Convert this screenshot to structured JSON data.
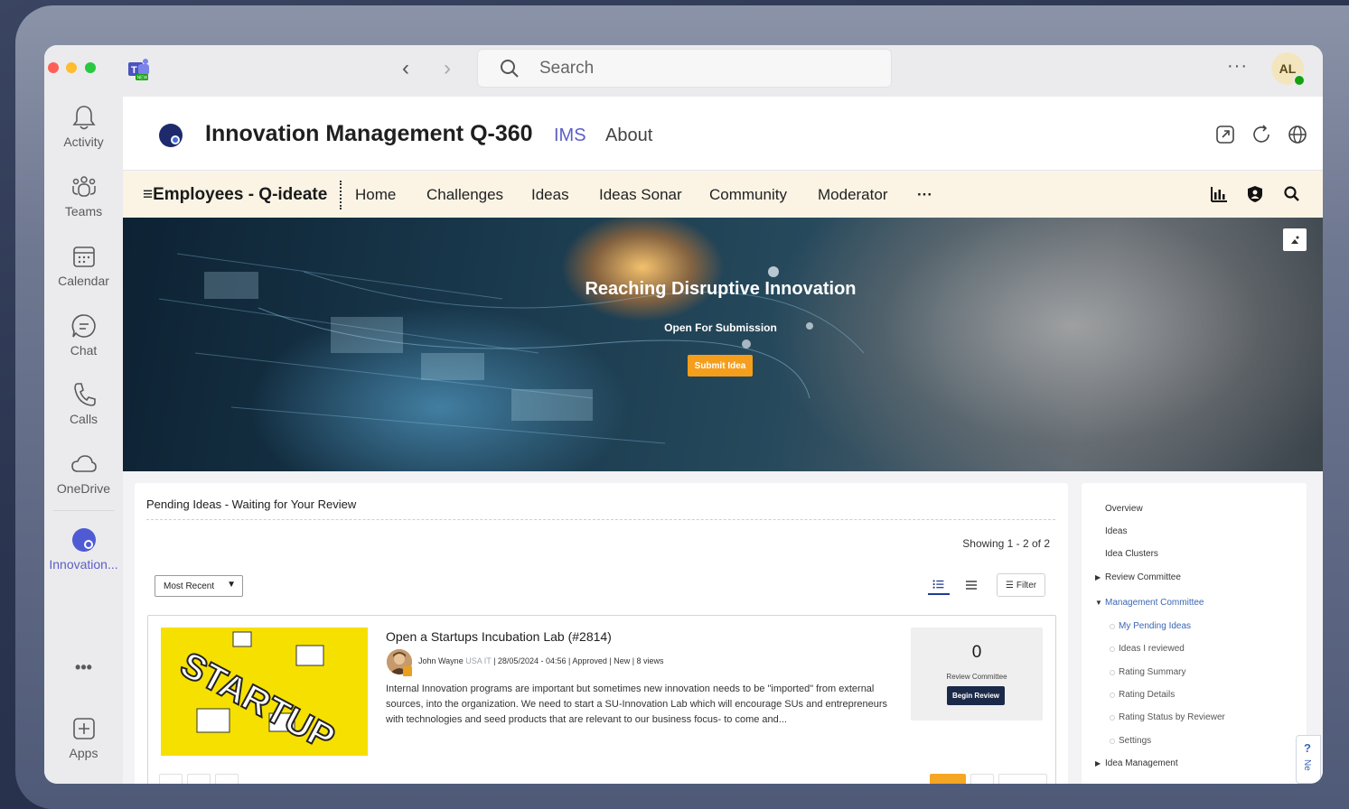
{
  "titlebar": {
    "search_placeholder": "Search",
    "more": "···",
    "avatar_initials": "AL"
  },
  "rail": {
    "items": [
      {
        "label": "Activity",
        "icon": "bell-icon"
      },
      {
        "label": "Teams",
        "icon": "teams-icon"
      },
      {
        "label": "Calendar",
        "icon": "calendar-icon"
      },
      {
        "label": "Chat",
        "icon": "chat-icon"
      },
      {
        "label": "Calls",
        "icon": "phone-icon"
      },
      {
        "label": "OneDrive",
        "icon": "cloud-icon"
      },
      {
        "label": "Innovation...",
        "icon": "innovation-app-icon"
      },
      {
        "label": "Apps",
        "icon": "apps-plus-icon"
      }
    ],
    "more": "•••"
  },
  "app_header": {
    "title": "Innovation Management Q-360",
    "tabs": [
      "IMS",
      "About"
    ]
  },
  "nav": {
    "brand": "≡Employees - Q-ideate",
    "links": [
      "Home",
      "Challenges",
      "Ideas",
      "Ideas Sonar",
      "Community",
      "Moderator",
      "···"
    ]
  },
  "hero": {
    "title": "Reaching Disruptive Innovation",
    "subtitle": "Open For Submission",
    "button": "Submit Idea"
  },
  "panel": {
    "title": "Pending Ideas - Waiting for Your Review",
    "showing": "Showing 1 - 2 of 2",
    "sort_value": "Most Recent",
    "filter_label": "Filter",
    "ideas": [
      {
        "title": "Open a Startups Incubation Lab (#2814)",
        "author": "John Wayne",
        "location": "USA IT",
        "meta": " | 28/05/2024 - 04:56 | Approved | New | 8 views",
        "description": "Internal Innovation programs are important but sometimes new innovation needs to be \"imported\" from external sources, into the organization. We need to start a SU-Innovation Lab which will encourage SUs and entrepreneurs with technologies and seed products that are relevant to our business focus- to come and...",
        "thumbnail_text": "STARTUP",
        "score": "0",
        "score_label": "Review Committee",
        "action": "Begin Review"
      }
    ]
  },
  "side": {
    "items": [
      {
        "label": "Overview"
      },
      {
        "label": "Ideas"
      },
      {
        "label": "Idea Clusters"
      },
      {
        "label": "Review Committee"
      },
      {
        "label": "Management Committee"
      },
      {
        "label": "My Pending Ideas"
      },
      {
        "label": "Ideas I reviewed"
      },
      {
        "label": "Rating Summary"
      },
      {
        "label": "Rating Details"
      },
      {
        "label": "Rating Status by Reviewer"
      },
      {
        "label": "Settings"
      },
      {
        "label": "Idea Management"
      }
    ]
  },
  "help": {
    "q": "?",
    "label": "Ne"
  },
  "colors": {
    "accent": "#5b5fc7",
    "nav_bg": "#fbf4e5",
    "hero_button": "#f59e1b",
    "review_button": "#1c2a4a",
    "link_blue": "#3a67b4"
  }
}
